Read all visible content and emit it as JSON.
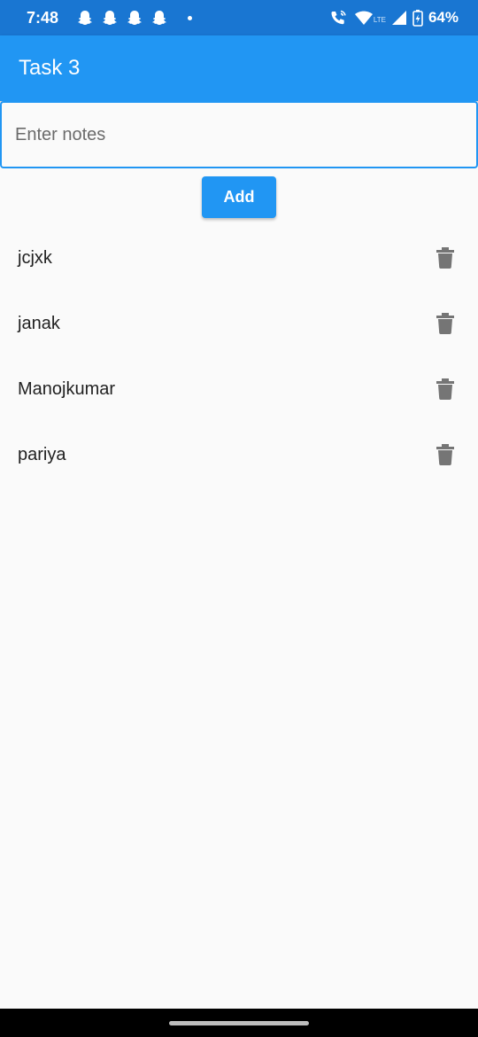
{
  "status_bar": {
    "time": "7:48",
    "notification_icons": [
      "snapchat-icon",
      "snapchat-icon",
      "snapchat-icon",
      "snapchat-icon"
    ],
    "network_label": "LTE",
    "battery": "64%"
  },
  "app_bar": {
    "title": "Task 3"
  },
  "notes_input": {
    "placeholder": "Enter notes",
    "value": ""
  },
  "add_button": {
    "label": "Add"
  },
  "notes": [
    {
      "label": "jcjxk"
    },
    {
      "label": "janak"
    },
    {
      "label": "Manojkumar"
    },
    {
      "label": "pariya"
    }
  ],
  "colors": {
    "primary": "#2196f3",
    "status_bar": "#1976d2",
    "icon_grey": "#757575",
    "background": "#fafafa"
  }
}
